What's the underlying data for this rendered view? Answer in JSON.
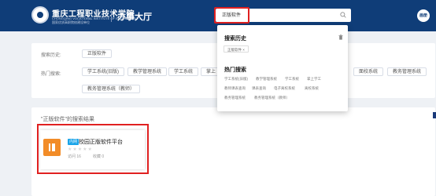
{
  "header": {
    "school_name": "重庆工程职业技术学院",
    "school_en": "CHONGQING VOCATIONAL INSTITUTE OF ENGINEERING",
    "school_sub": "国家优质高职院校建设单位",
    "site_title": "办事大厅",
    "search_value": "正版软件",
    "avatar_text": "画册"
  },
  "history_row": {
    "label": "搜索历史:",
    "items": [
      "正版软件"
    ]
  },
  "hot_row": {
    "label": "热门搜索:",
    "items": [
      "学工系统(旧版)",
      "教学管理系统",
      "学工系统",
      "掌上",
      "面校系统",
      "教务管理系统",
      "教务管理系统（教师）"
    ]
  },
  "results": {
    "title": "\"正版软件\"的搜索结果",
    "app": {
      "badge": "内网",
      "name": "校园正版软件平台",
      "stars": "★★★★★",
      "usage": "访问 16",
      "fav": "收藏 0"
    }
  },
  "dropdown": {
    "history_title": "搜索历史",
    "history_item": "正版软件",
    "hot_title": "热门搜索",
    "hot_links": [
      "学工系统(旧版)",
      "教学管理系统",
      "学工系统",
      "掌上学工",
      "教师课表查询",
      "课表查询",
      "电子离校系统",
      "离校系统",
      "教务管理系统",
      "教务管理系统（教师）"
    ]
  },
  "colors": {
    "header": "#0f3d78",
    "highlight": "#e02020",
    "app_icon": "#f28c28",
    "badge": "#1aa4e8"
  }
}
